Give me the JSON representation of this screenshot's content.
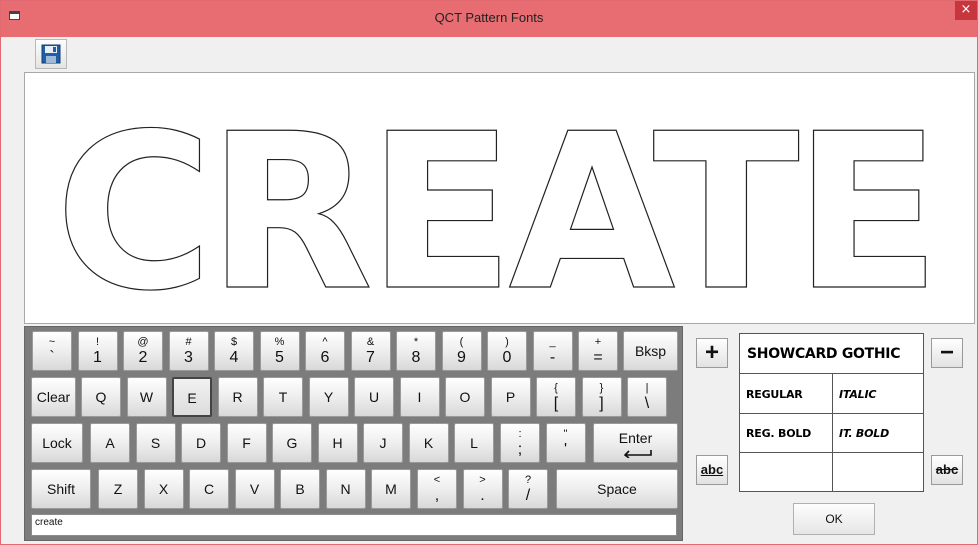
{
  "window": {
    "title": "QCT Pattern Fonts",
    "close_glyph": "×"
  },
  "toolbar": {
    "save_icon": "floppy-disk-icon"
  },
  "canvas": {
    "text": "CREATE"
  },
  "keyboard": {
    "row1": [
      {
        "top": "~",
        "bot": "`"
      },
      {
        "top": "!",
        "bot": "1"
      },
      {
        "top": "@",
        "bot": "2"
      },
      {
        "top": "#",
        "bot": "3"
      },
      {
        "top": "$",
        "bot": "4"
      },
      {
        "top": "%",
        "bot": "5"
      },
      {
        "top": "^",
        "bot": "6"
      },
      {
        "top": "&",
        "bot": "7"
      },
      {
        "top": "*",
        "bot": "8"
      },
      {
        "top": "(",
        "bot": "9"
      },
      {
        "top": ")",
        "bot": "0"
      },
      {
        "top": "_",
        "bot": "-"
      },
      {
        "top": "+",
        "bot": "="
      }
    ],
    "bksp": "Bksp",
    "clear": "Clear",
    "row2": [
      "Q",
      "W",
      "E",
      "R",
      "T",
      "Y",
      "U",
      "I",
      "O",
      "P"
    ],
    "row2_sym": [
      {
        "top": "{",
        "bot": "["
      },
      {
        "top": "}",
        "bot": "]"
      },
      {
        "top": "|",
        "bot": "\\"
      }
    ],
    "lock": "Lock",
    "row3": [
      "A",
      "S",
      "D",
      "F",
      "G",
      "H",
      "J",
      "K",
      "L"
    ],
    "row3_sym": [
      {
        "top": ":",
        "bot": ";"
      },
      {
        "top": "\"",
        "bot": "'"
      }
    ],
    "enter": "Enter",
    "shift": "Shift",
    "row4": [
      "Z",
      "X",
      "C",
      "V",
      "B",
      "N",
      "M"
    ],
    "row4_sym": [
      {
        "top": "<",
        "bot": ","
      },
      {
        "top": ">",
        "bot": "."
      },
      {
        "top": "?",
        "bot": "/"
      }
    ],
    "space": "Space",
    "pressed_key": "E"
  },
  "input": {
    "value": "create"
  },
  "font_panel": {
    "increase_label": "+",
    "decrease_label": "−",
    "underline_label": "abc",
    "strike_label": "abc",
    "font_name": "SHOWCARD GOTHIC",
    "styles": {
      "regular": "REGULAR",
      "italic": "ITALIC",
      "reg_bold": "REG. BOLD",
      "it_bold": "IT. BOLD"
    }
  },
  "ok_label": "OK"
}
